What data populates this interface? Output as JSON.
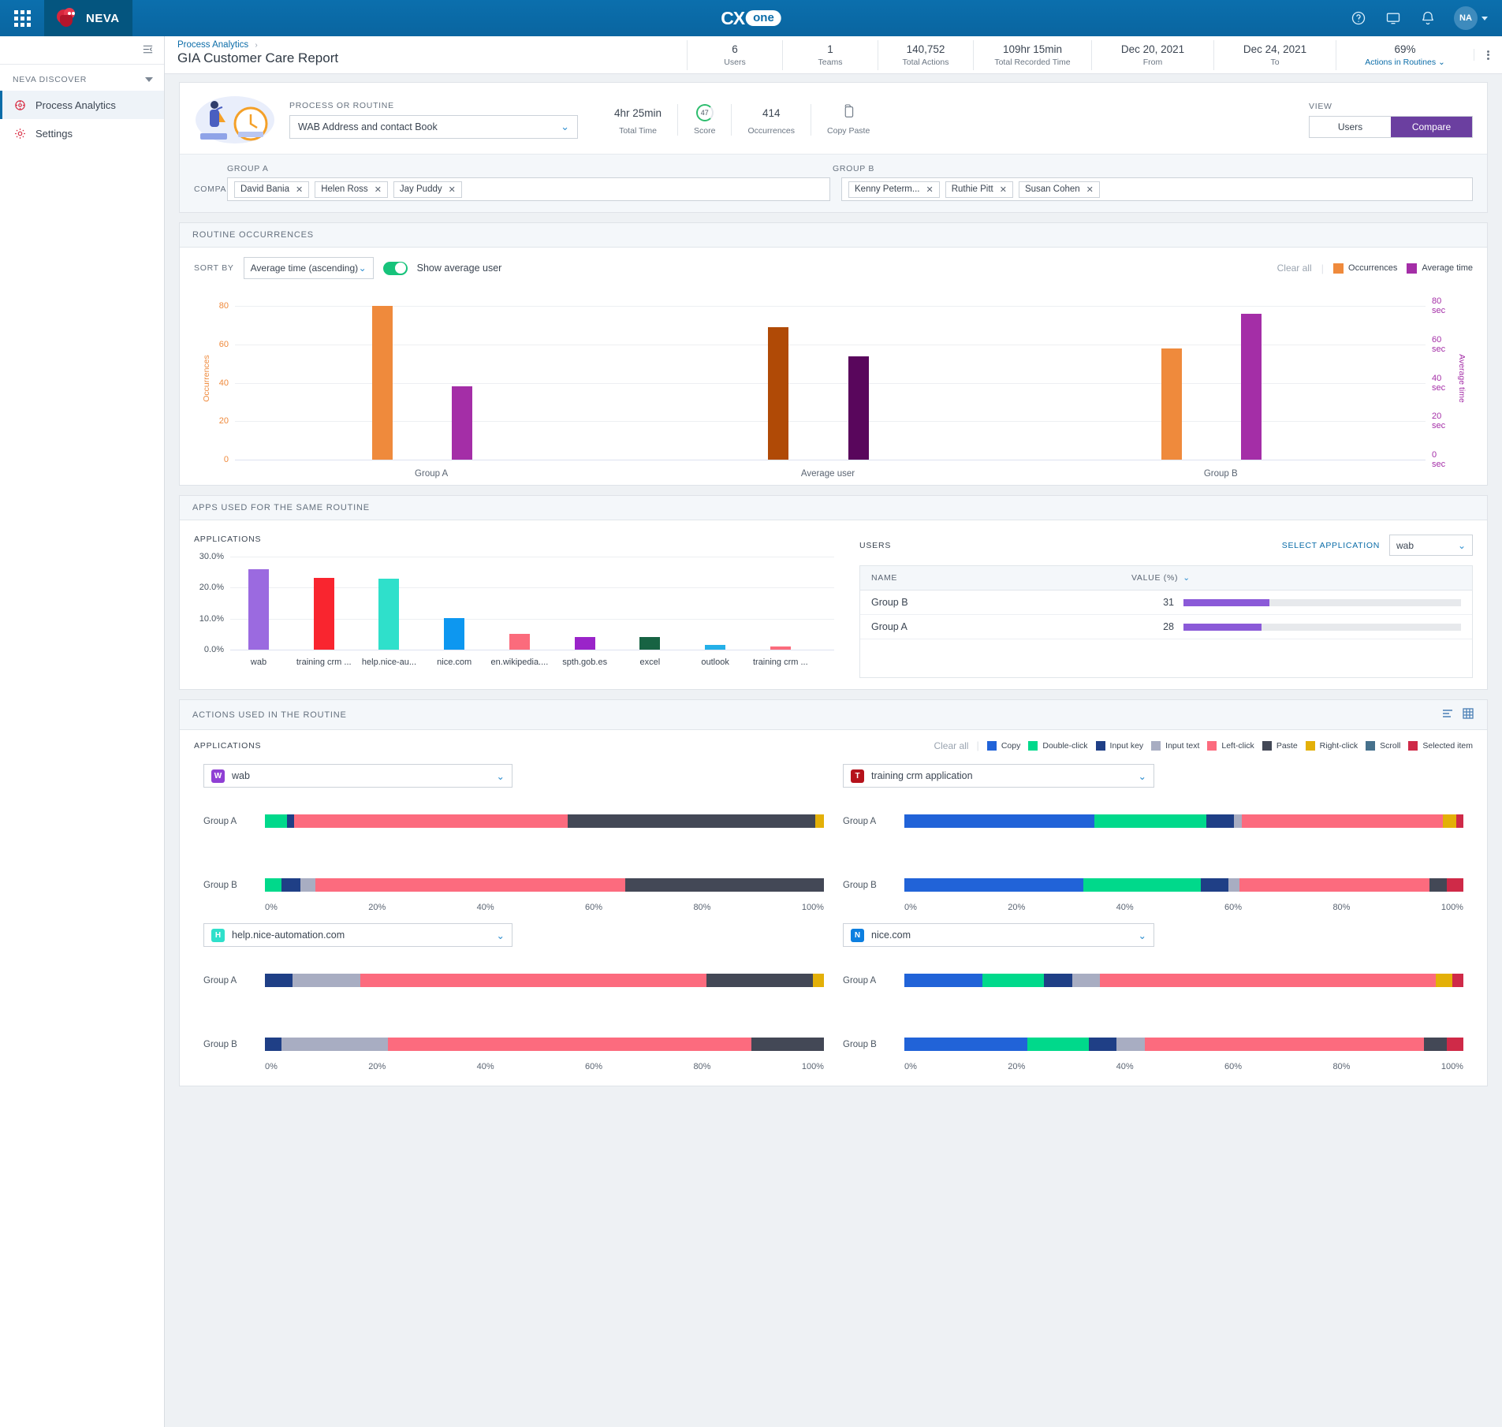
{
  "topbar": {
    "waffle_icon": "apps-grid-icon",
    "product": "NEVA",
    "brand_cx": "CX",
    "brand_one": "one",
    "help_icon": "help-circle-icon",
    "feedback_icon": "monitor-icon",
    "bell_icon": "bell-icon",
    "avatar_initials": "NA"
  },
  "sidebar": {
    "collapse_icon": "collapse-panel-icon",
    "section": "NEVA DISCOVER",
    "items": [
      {
        "label": "Process Analytics",
        "icon": "analytics-icon",
        "active": true
      },
      {
        "label": "Settings",
        "icon": "gear-icon",
        "active": false
      }
    ]
  },
  "header": {
    "breadcrumb": "Process Analytics",
    "breadcrumb_sep": "›",
    "title": "GIA Customer Care Report",
    "stats": [
      {
        "value": "6",
        "label": "Users"
      },
      {
        "value": "1",
        "label": "Teams"
      },
      {
        "value": "140,752",
        "label": "Total Actions"
      },
      {
        "value": "109hr 15min",
        "label": "Total Recorded Time"
      },
      {
        "value": "Dec 20, 2021",
        "label": "From"
      },
      {
        "value": "Dec 24, 2021",
        "label": "To"
      },
      {
        "value": "69%",
        "label": "Actions in Routines ⌄",
        "link": true
      }
    ],
    "kebab_icon": "more-vertical-icon"
  },
  "routine": {
    "field_label": "PROCESS OR ROUTINE",
    "selected": "WAB Address and contact Book",
    "chevron": "⌄",
    "metrics": [
      {
        "value": "4hr 25min",
        "label": "Total Time"
      },
      {
        "value": "47",
        "label": "Score"
      },
      {
        "value": "414",
        "label": "Occurrences"
      },
      {
        "value": "",
        "label": "Copy Paste"
      }
    ],
    "view_label": "VIEW",
    "view_options": [
      "Users",
      "Compare"
    ],
    "view_selected": "Compare",
    "compare_label": "COMPARE",
    "group_a_label": "GROUP A",
    "group_b_label": "GROUP B",
    "group_a_chips": [
      "David Bania",
      "Helen Ross",
      "Jay Puddy"
    ],
    "group_b_chips": [
      "Kenny Peterm...",
      "Ruthie Pitt",
      "Susan Cohen"
    ],
    "chip_remove": "✕"
  },
  "occurrences": {
    "card_title": "ROUTINE OCCURRENCES",
    "sort_label": "SORT BY",
    "sort_value": "Average time (ascending)",
    "toggle_label": "Show average user",
    "toggle_on": true,
    "clear_all": "Clear all",
    "legend": [
      {
        "label": "Occurrences",
        "color": "#ef8a3c"
      },
      {
        "label": "Average time",
        "color": "#a42ea7"
      }
    ]
  },
  "apps": {
    "card_title": "APPS USED FOR THE SAME ROUTINE",
    "applications_label": "APPLICATIONS",
    "users_label": "USERS",
    "select_application_label": "SELECT APPLICATION",
    "select_application_value": "wab",
    "table": {
      "columns": [
        "NAME",
        "VALUE (%)"
      ],
      "sort_icon": "chevron-down-icon",
      "rows": [
        {
          "name": "Group B",
          "value": "31",
          "pct": 31
        },
        {
          "name": "Group A",
          "value": "28",
          "pct": 28
        }
      ],
      "bar_color": "#8b5ad8"
    }
  },
  "actions": {
    "card_title": "ACTIONS USED IN THE ROUTINE",
    "view_icons": [
      "bar-view-icon",
      "grid-view-icon"
    ],
    "applications_label": "APPLICATIONS",
    "clear_all": "Clear all",
    "legend": [
      {
        "label": "Copy",
        "color": "#2163d8"
      },
      {
        "label": "Double-click",
        "color": "#00d98b"
      },
      {
        "label": "Input key",
        "color": "#1f3f86"
      },
      {
        "label": "Input text",
        "color": "#a8adc2"
      },
      {
        "label": "Left-click",
        "color": "#fc6b7e"
      },
      {
        "label": "Paste",
        "color": "#434856"
      },
      {
        "label": "Right-click",
        "color": "#e3b008"
      },
      {
        "label": "Scroll",
        "color": "#46718c"
      },
      {
        "label": "Selected item",
        "color": "#cf2a48"
      }
    ],
    "axis_ticks": [
      "0%",
      "20%",
      "40%",
      "60%",
      "80%",
      "100%"
    ],
    "row_labels": [
      "Group A",
      "Group B"
    ]
  },
  "chart_data": [
    {
      "type": "bar",
      "title": "Routine occurrences",
      "categories": [
        "Group A",
        "Average user",
        "Group B"
      ],
      "series": [
        {
          "name": "Occurrences",
          "values": [
            80,
            69,
            58
          ],
          "color": "#ef8a3c",
          "avg_color": "#b04a06"
        },
        {
          "name": "Average time",
          "values": [
            38,
            54,
            76
          ],
          "color": "#a42ea7",
          "avg_color": "#59065c"
        }
      ],
      "ylabel": "Occurrences",
      "y2label": "Average time",
      "yticks": [
        0,
        20,
        40,
        60,
        80
      ],
      "y2ticks": [
        "0 sec",
        "20 sec",
        "40 sec",
        "60 sec",
        "80 sec"
      ],
      "ylim": [
        0,
        85
      ],
      "grid": true,
      "legend": "top-right"
    },
    {
      "type": "bar",
      "title": "Applications",
      "categories": [
        "wab",
        "training crm ...",
        "help.nice-au...",
        "nice.com",
        "en.wikipedia....",
        "spth.gob.es",
        "excel",
        "outlook",
        "training crm ..."
      ],
      "values": [
        26.0,
        23.2,
        22.9,
        10.2,
        5.0,
        4.0,
        4.0,
        1.4,
        1.1
      ],
      "colors": [
        "#9b6ae0",
        "#f9252f",
        "#2fe0cb",
        "#0d97f0",
        "#fb6b7c",
        "#9a24c9",
        "#176343",
        "#24b0e8",
        "#fb6b7c"
      ],
      "ylabel": "",
      "yticks": [
        "0.0%",
        "10.0%",
        "20.0%",
        "30.0%"
      ],
      "ylim": [
        0,
        30
      ],
      "grid": true
    },
    {
      "type": "bar",
      "orientation": "horizontal-stacked",
      "title": "wab",
      "app": "wab",
      "app_tile": {
        "letter": "W",
        "color": "#8f3fd4"
      },
      "categories": [
        "Group A",
        "Group B"
      ],
      "series": [
        {
          "name": "Double-click",
          "color": "#00d98b",
          "values": [
            4.0,
            3.0
          ]
        },
        {
          "name": "Input key",
          "color": "#1f3f86",
          "values": [
            1.2,
            3.4
          ]
        },
        {
          "name": "Input text",
          "color": "#a8adc2",
          "values": [
            0.0,
            2.6
          ]
        },
        {
          "name": "Left-click",
          "color": "#fc6b7e",
          "values": [
            49.0,
            55.4
          ]
        },
        {
          "name": "Paste",
          "color": "#434856",
          "values": [
            44.3,
            35.6
          ]
        },
        {
          "name": "Right-click",
          "color": "#e3b008",
          "values": [
            1.5,
            0.0
          ]
        }
      ],
      "xticks": [
        "0%",
        "20%",
        "40%",
        "60%",
        "80%",
        "100%"
      ]
    },
    {
      "type": "bar",
      "orientation": "horizontal-stacked",
      "title": "training crm application",
      "app": "training crm application",
      "app_tile": {
        "letter": "T",
        "color": "#b5121b"
      },
      "categories": [
        "Group A",
        "Group B"
      ],
      "series": [
        {
          "name": "Copy",
          "color": "#2163d8",
          "values": [
            34.0,
            32.0
          ]
        },
        {
          "name": "Double-click",
          "color": "#00d98b",
          "values": [
            20.0,
            21.0
          ]
        },
        {
          "name": "Input key",
          "color": "#1f3f86",
          "values": [
            5.0,
            5.0
          ]
        },
        {
          "name": "Input text",
          "color": "#a8adc2",
          "values": [
            1.4,
            2.0
          ]
        },
        {
          "name": "Left-click",
          "color": "#fc6b7e",
          "values": [
            36.0,
            34.0
          ]
        },
        {
          "name": "Paste",
          "color": "#434856",
          "values": [
            0.0,
            3.0
          ]
        },
        {
          "name": "Right-click",
          "color": "#e3b008",
          "values": [
            2.3,
            0.0
          ]
        },
        {
          "name": "Selected item",
          "color": "#cf2a48",
          "values": [
            1.3,
            3.0
          ]
        }
      ],
      "xticks": [
        "0%",
        "20%",
        "40%",
        "60%",
        "80%",
        "100%"
      ]
    },
    {
      "type": "bar",
      "orientation": "horizontal-stacked",
      "title": "help.nice-automation.com",
      "app": "help.nice-automation.com",
      "app_tile": {
        "letter": "H",
        "color": "#2fe0cb"
      },
      "categories": [
        "Group A",
        "Group B"
      ],
      "series": [
        {
          "name": "Input key",
          "color": "#1f3f86",
          "values": [
            5.0,
            3.0
          ]
        },
        {
          "name": "Input text",
          "color": "#a8adc2",
          "values": [
            12.0,
            19.0
          ]
        },
        {
          "name": "Left-click",
          "color": "#fc6b7e",
          "values": [
            62.0,
            65.0
          ]
        },
        {
          "name": "Paste",
          "color": "#434856",
          "values": [
            19.0,
            13.0
          ]
        },
        {
          "name": "Right-click",
          "color": "#e3b008",
          "values": [
            2.0,
            0.0
          ]
        }
      ],
      "xticks": [
        "0%",
        "20%",
        "40%",
        "60%",
        "80%",
        "100%"
      ]
    },
    {
      "type": "bar",
      "orientation": "horizontal-stacked",
      "title": "nice.com",
      "app": "nice.com",
      "app_tile": {
        "letter": "N",
        "color": "#0d7fe0"
      },
      "categories": [
        "Group A",
        "Group B"
      ],
      "series": [
        {
          "name": "Copy",
          "color": "#2163d8",
          "values": [
            14.0,
            22.0
          ]
        },
        {
          "name": "Double-click",
          "color": "#00d98b",
          "values": [
            11.0,
            11.0
          ]
        },
        {
          "name": "Input key",
          "color": "#1f3f86",
          "values": [
            5.0,
            5.0
          ]
        },
        {
          "name": "Input text",
          "color": "#a8adc2",
          "values": [
            5.0,
            5.0
          ]
        },
        {
          "name": "Left-click",
          "color": "#fc6b7e",
          "values": [
            60.0,
            50.0
          ]
        },
        {
          "name": "Paste",
          "color": "#434856",
          "values": [
            0.0,
            4.0
          ]
        },
        {
          "name": "Right-click",
          "color": "#e3b008",
          "values": [
            3.0,
            0.0
          ]
        },
        {
          "name": "Selected item",
          "color": "#cf2a48",
          "values": [
            2.0,
            3.0
          ]
        }
      ],
      "xticks": [
        "0%",
        "20%",
        "40%",
        "60%",
        "80%",
        "100%"
      ]
    }
  ]
}
